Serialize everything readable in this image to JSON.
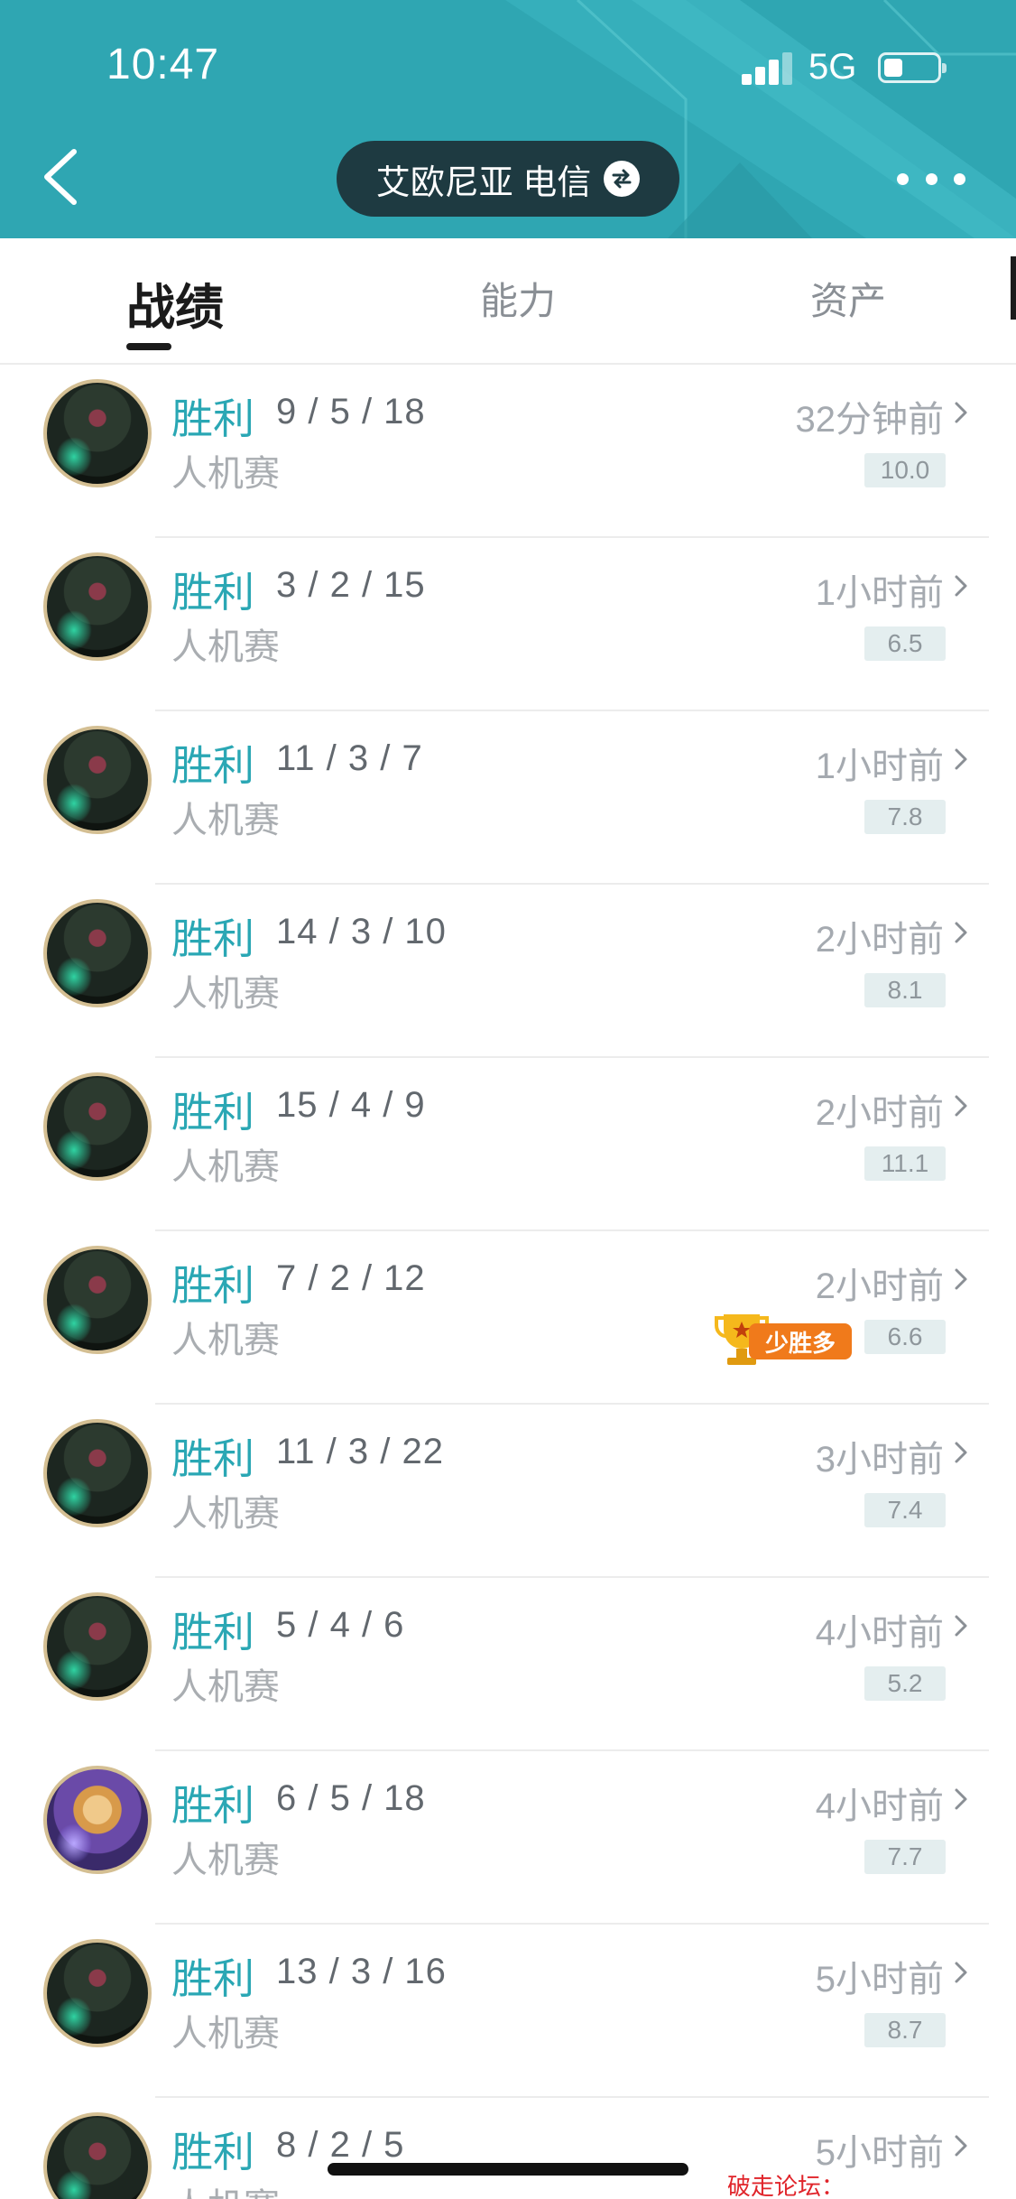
{
  "status_bar": {
    "time": "10:47",
    "network": "5G",
    "battery_level": 0.3
  },
  "header": {
    "server_name": "艾欧尼亚 电信",
    "icons": {
      "back": "chevron-left-icon",
      "swap": "swap-icon",
      "more": "more-dots-icon"
    },
    "colors": {
      "background": "#2fa6b2",
      "pill": "#1e3a41"
    }
  },
  "tabs": [
    {
      "label": "战绩",
      "active": true
    },
    {
      "label": "能力",
      "active": false
    },
    {
      "label": "资产",
      "active": false
    }
  ],
  "matches": [
    {
      "result": "胜利",
      "kda": "9 / 5 / 18",
      "mode": "人机赛",
      "time": "32分钟前",
      "score": "10.0",
      "badge": "",
      "avatar": "champion-avatar-dark"
    },
    {
      "result": "胜利",
      "kda": "3 / 2 / 15",
      "mode": "人机赛",
      "time": "1小时前",
      "score": "6.5",
      "badge": "",
      "avatar": "champion-avatar-dark"
    },
    {
      "result": "胜利",
      "kda": "11 / 3 / 7",
      "mode": "人机赛",
      "time": "1小时前",
      "score": "7.8",
      "badge": "",
      "avatar": "champion-avatar-dark"
    },
    {
      "result": "胜利",
      "kda": "14 / 3 / 10",
      "mode": "人机赛",
      "time": "2小时前",
      "score": "8.1",
      "badge": "",
      "avatar": "champion-avatar-dark"
    },
    {
      "result": "胜利",
      "kda": "15 / 4 / 9",
      "mode": "人机赛",
      "time": "2小时前",
      "score": "11.1",
      "badge": "",
      "avatar": "champion-avatar-dark"
    },
    {
      "result": "胜利",
      "kda": "7 / 2 / 12",
      "mode": "人机赛",
      "time": "2小时前",
      "score": "6.6",
      "badge": "少胜多",
      "avatar": "champion-avatar-dark"
    },
    {
      "result": "胜利",
      "kda": "11 / 3 / 22",
      "mode": "人机赛",
      "time": "3小时前",
      "score": "7.4",
      "badge": "",
      "avatar": "champion-avatar-dark"
    },
    {
      "result": "胜利",
      "kda": "5 / 4 / 6",
      "mode": "人机赛",
      "time": "4小时前",
      "score": "5.2",
      "badge": "",
      "avatar": "champion-avatar-dark"
    },
    {
      "result": "胜利",
      "kda": "6 / 5 / 18",
      "mode": "人机赛",
      "time": "4小时前",
      "score": "7.7",
      "badge": "",
      "avatar": "champion-avatar-ezreal"
    },
    {
      "result": "胜利",
      "kda": "13 / 3 / 16",
      "mode": "人机赛",
      "time": "5小时前",
      "score": "8.7",
      "badge": "",
      "avatar": "champion-avatar-dark"
    },
    {
      "result": "胜利",
      "kda": "8 / 2 / 5",
      "mode": "人机赛",
      "time": "5小时前",
      "score": "",
      "badge": "",
      "avatar": "champion-avatar-dark"
    }
  ],
  "colors": {
    "win": "#2aa7b4",
    "score_bg": "#e4eeef",
    "badge": "#f07a1b"
  },
  "watermark": "破走论坛：www.pozou.com"
}
